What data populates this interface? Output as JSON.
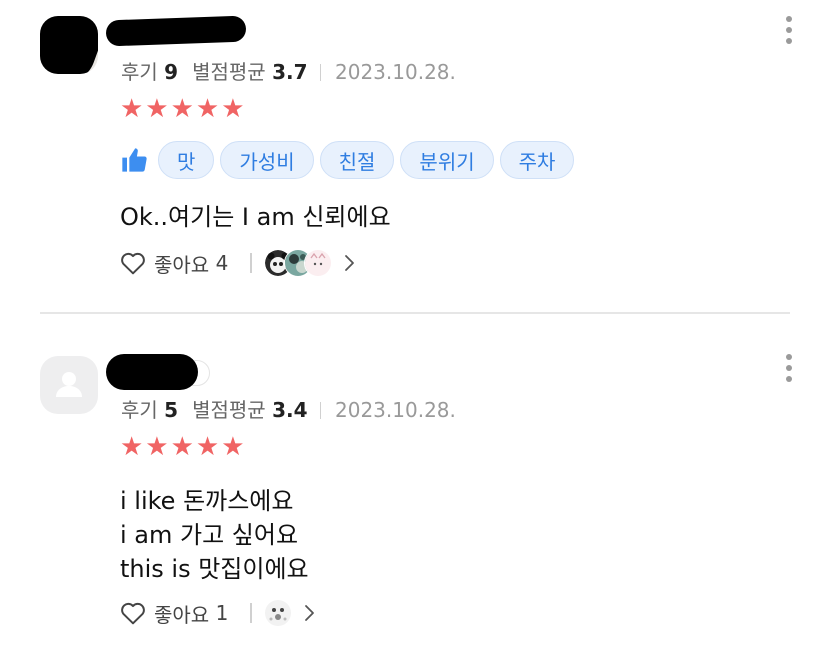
{
  "reviews": [
    {
      "meta": {
        "review_label": "후기",
        "review_count": "9",
        "avg_label": "별점평균",
        "avg_value": "3.7",
        "date": "2023.10.28."
      },
      "stars": "★★★★★",
      "tags": [
        "맛",
        "가성비",
        "친절",
        "분위기",
        "주차"
      ],
      "text_lines": [
        "Ok..여기는 I am 신뢰에요"
      ],
      "likes": {
        "label": "좋아요",
        "count": "4"
      },
      "rating": 5
    },
    {
      "meta": {
        "review_label": "후기",
        "review_count": "5",
        "avg_label": "별점평균",
        "avg_value": "3.4",
        "date": "2023.10.28."
      },
      "stars": "★★★★★",
      "text_lines": [
        "i like 돈까스에요",
        "i am 가고 싶어요",
        "this is 맛집이에요"
      ],
      "likes": {
        "label": "좋아요",
        "count": "1"
      },
      "rating": 5
    }
  ],
  "colors": {
    "star": "#f06464",
    "tag_text": "#2f7de1",
    "tag_bg": "#e8f1fd",
    "thumb": "#3d8ef0"
  },
  "icons": [
    "more-vertical-icon",
    "thumbs-up-icon",
    "heart-outline-icon",
    "chevron-right-icon",
    "person-icon"
  ]
}
